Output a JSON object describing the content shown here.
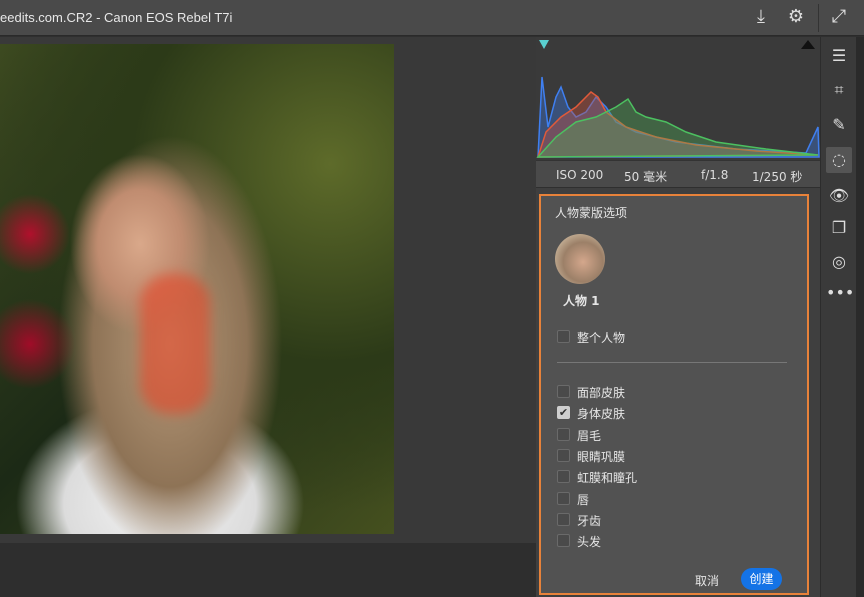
{
  "header": {
    "title": "eedits.com.CR2 -  Canon EOS Rebel T7i",
    "icons": [
      "export-icon",
      "settings-icon",
      "expand-icon"
    ]
  },
  "exif": {
    "iso": "ISO 200",
    "focal": "50 毫米",
    "aperture": "f/1.8",
    "shutter": "1/250 秒"
  },
  "mask_panel": {
    "title": "人物蒙版选项",
    "person_label": "人物 1",
    "whole_person": {
      "label": "整个人物",
      "checked": false
    },
    "options": [
      {
        "label": "面部皮肤",
        "checked": false
      },
      {
        "label": "身体皮肤",
        "checked": true
      },
      {
        "label": "眉毛",
        "checked": false
      },
      {
        "label": "眼睛巩膜",
        "checked": false
      },
      {
        "label": "虹膜和瞳孔",
        "checked": false
      },
      {
        "label": "唇",
        "checked": false
      },
      {
        "label": "牙齿",
        "checked": false
      },
      {
        "label": "头发",
        "checked": false
      }
    ],
    "cancel_label": "取消",
    "create_label": "创建"
  },
  "colors": {
    "accent": "#1473e6",
    "highlight_border": "#e8823a"
  }
}
